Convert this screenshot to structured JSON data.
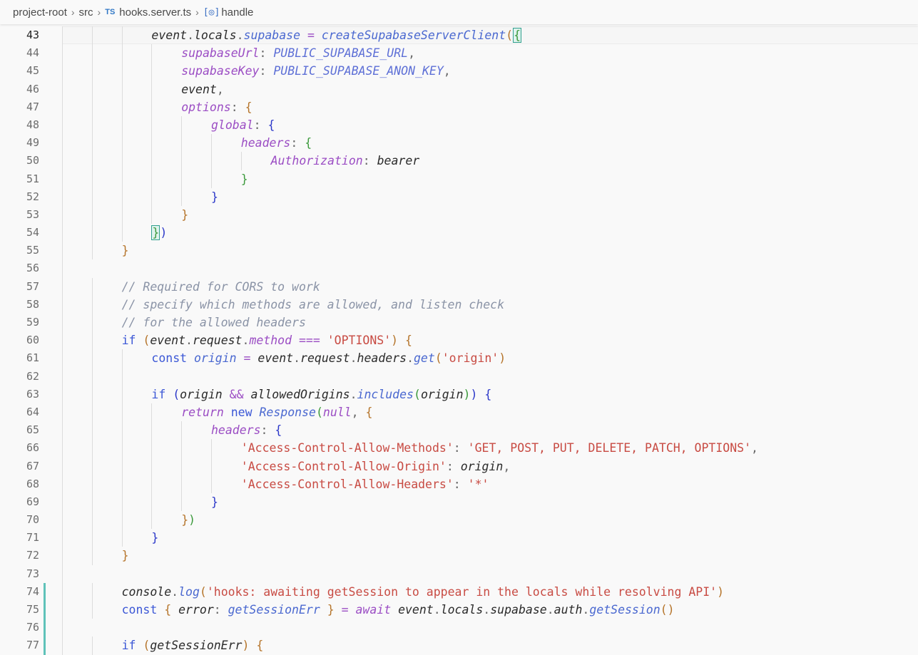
{
  "breadcrumb": {
    "root": "project-root",
    "folder": "src",
    "file_icon": "TS",
    "file": "hooks.server.ts",
    "symbol": "handle",
    "symbol_icon": "symbol-variable-icon"
  },
  "colors": {
    "keyword": "#3b57d6",
    "property": "#9b4dc4",
    "variable": "#2a2a2a",
    "function": "#4a68d0",
    "string": "#c84b43",
    "comment": "#8a93a6",
    "constant": "#5d6fd6",
    "operator": "#9b4dc4",
    "punctuation": "#666666",
    "bracket_1": "#b5742a",
    "bracket_2": "#2c38c9",
    "bracket_3": "#3c9a3c",
    "modified_gutter": "#5fc2b9"
  },
  "lines": [
    {
      "n": "43",
      "indent": 3,
      "current": true,
      "tokens": [
        [
          "event",
          "v"
        ],
        [
          ".",
          "p"
        ],
        [
          "locals",
          "v"
        ],
        [
          ".",
          "p"
        ],
        [
          "supabase",
          "f"
        ],
        [
          " = ",
          "o"
        ],
        [
          "createSupabaseServerClient",
          "f"
        ],
        [
          "(",
          "b1"
        ],
        [
          "{",
          "bm"
        ]
      ]
    },
    {
      "n": "44",
      "indent": 4,
      "tokens": [
        [
          "supabaseUrl",
          "pr"
        ],
        [
          ": ",
          "p"
        ],
        [
          "PUBLIC_SUPABASE_URL",
          "c"
        ],
        [
          ",",
          "p"
        ]
      ]
    },
    {
      "n": "45",
      "indent": 4,
      "tokens": [
        [
          "supabaseKey",
          "pr"
        ],
        [
          ": ",
          "p"
        ],
        [
          "PUBLIC_SUPABASE_ANON_KEY",
          "c"
        ],
        [
          ",",
          "p"
        ]
      ]
    },
    {
      "n": "46",
      "indent": 4,
      "tokens": [
        [
          "event",
          "v"
        ],
        [
          ",",
          "p"
        ]
      ]
    },
    {
      "n": "47",
      "indent": 4,
      "tokens": [
        [
          "options",
          "pr"
        ],
        [
          ": ",
          "p"
        ],
        [
          "{",
          "b1"
        ]
      ]
    },
    {
      "n": "48",
      "indent": 5,
      "tokens": [
        [
          "global",
          "pr"
        ],
        [
          ": ",
          "p"
        ],
        [
          "{",
          "b2"
        ]
      ]
    },
    {
      "n": "49",
      "indent": 6,
      "tokens": [
        [
          "headers",
          "pr"
        ],
        [
          ": ",
          "p"
        ],
        [
          "{",
          "b3"
        ]
      ]
    },
    {
      "n": "50",
      "indent": 7,
      "tokens": [
        [
          "Authorization",
          "pr"
        ],
        [
          ": ",
          "p"
        ],
        [
          "bearer",
          "v"
        ]
      ]
    },
    {
      "n": "51",
      "indent": 6,
      "tokens": [
        [
          "}",
          "b3"
        ]
      ]
    },
    {
      "n": "52",
      "indent": 5,
      "tokens": [
        [
          "}",
          "b2"
        ]
      ]
    },
    {
      "n": "53",
      "indent": 4,
      "tokens": [
        [
          "}",
          "b1"
        ]
      ]
    },
    {
      "n": "54",
      "indent": 3,
      "tokens": [
        [
          "}",
          "bm"
        ],
        [
          ")",
          "b2"
        ]
      ]
    },
    {
      "n": "55",
      "indent": 2,
      "tokens": [
        [
          "}",
          "b1"
        ]
      ]
    },
    {
      "n": "56",
      "indent": 1,
      "tokens": []
    },
    {
      "n": "57",
      "indent": 2,
      "tokens": [
        [
          "// Required for CORS to work",
          "cm"
        ]
      ]
    },
    {
      "n": "58",
      "indent": 2,
      "tokens": [
        [
          "// specify which methods are allowed, and listen check",
          "cm"
        ]
      ]
    },
    {
      "n": "59",
      "indent": 2,
      "tokens": [
        [
          "// for the allowed headers",
          "cm"
        ]
      ]
    },
    {
      "n": "60",
      "indent": 2,
      "tokens": [
        [
          "if ",
          "k"
        ],
        [
          "(",
          "b1"
        ],
        [
          "event",
          "v"
        ],
        [
          ".",
          "p"
        ],
        [
          "request",
          "v"
        ],
        [
          ".",
          "p"
        ],
        [
          "method",
          "pr"
        ],
        [
          " === ",
          "o"
        ],
        [
          "'OPTIONS'",
          "s"
        ],
        [
          ") ",
          "b1"
        ],
        [
          "{",
          "b1"
        ]
      ]
    },
    {
      "n": "61",
      "indent": 3,
      "tokens": [
        [
          "const ",
          "k"
        ],
        [
          "origin",
          "f"
        ],
        [
          " = ",
          "o"
        ],
        [
          "event",
          "v"
        ],
        [
          ".",
          "p"
        ],
        [
          "request",
          "v"
        ],
        [
          ".",
          "p"
        ],
        [
          "headers",
          "v"
        ],
        [
          ".",
          "p"
        ],
        [
          "get",
          "f"
        ],
        [
          "(",
          "b1"
        ],
        [
          "'origin'",
          "s"
        ],
        [
          ")",
          "b1"
        ]
      ]
    },
    {
      "n": "62",
      "indent": 3,
      "tokens": []
    },
    {
      "n": "63",
      "indent": 3,
      "tokens": [
        [
          "if ",
          "k"
        ],
        [
          "(",
          "b2"
        ],
        [
          "origin",
          "v"
        ],
        [
          " && ",
          "o"
        ],
        [
          "allowedOrigins",
          "v"
        ],
        [
          ".",
          "p"
        ],
        [
          "includes",
          "f"
        ],
        [
          "(",
          "b3"
        ],
        [
          "origin",
          "v"
        ],
        [
          ")",
          "b3"
        ],
        [
          ") ",
          "b2"
        ],
        [
          "{",
          "b2"
        ]
      ]
    },
    {
      "n": "64",
      "indent": 4,
      "tokens": [
        [
          "return ",
          "pr"
        ],
        [
          "new ",
          "k"
        ],
        [
          "Response",
          "f"
        ],
        [
          "(",
          "b3"
        ],
        [
          "null",
          "pr"
        ],
        [
          ", ",
          "p"
        ],
        [
          "{",
          "b1"
        ]
      ]
    },
    {
      "n": "65",
      "indent": 5,
      "tokens": [
        [
          "headers",
          "pr"
        ],
        [
          ": ",
          "p"
        ],
        [
          "{",
          "b2"
        ]
      ]
    },
    {
      "n": "66",
      "indent": 6,
      "tokens": [
        [
          "'Access-Control-Allow-Methods'",
          "s"
        ],
        [
          ": ",
          "p"
        ],
        [
          "'GET, POST, PUT, DELETE, PATCH, OPTIONS'",
          "s"
        ],
        [
          ",",
          "p"
        ]
      ]
    },
    {
      "n": "67",
      "indent": 6,
      "tokens": [
        [
          "'Access-Control-Allow-Origin'",
          "s"
        ],
        [
          ": ",
          "p"
        ],
        [
          "origin",
          "v"
        ],
        [
          ",",
          "p"
        ]
      ]
    },
    {
      "n": "68",
      "indent": 6,
      "tokens": [
        [
          "'Access-Control-Allow-Headers'",
          "s"
        ],
        [
          ": ",
          "p"
        ],
        [
          "'*'",
          "s"
        ]
      ]
    },
    {
      "n": "69",
      "indent": 5,
      "tokens": [
        [
          "}",
          "b2"
        ]
      ]
    },
    {
      "n": "70",
      "indent": 4,
      "tokens": [
        [
          "}",
          "b1"
        ],
        [
          ")",
          "b3"
        ]
      ]
    },
    {
      "n": "71",
      "indent": 3,
      "tokens": [
        [
          "}",
          "b2"
        ]
      ]
    },
    {
      "n": "72",
      "indent": 2,
      "tokens": [
        [
          "}",
          "b1"
        ]
      ]
    },
    {
      "n": "73",
      "indent": 1,
      "tokens": []
    },
    {
      "n": "74",
      "indent": 2,
      "modified": true,
      "tokens": [
        [
          "console",
          "v"
        ],
        [
          ".",
          "p"
        ],
        [
          "log",
          "f"
        ],
        [
          "(",
          "b1"
        ],
        [
          "'hooks: awaiting getSession to appear in the locals while resolving API'",
          "s"
        ],
        [
          ")",
          "b1"
        ]
      ]
    },
    {
      "n": "75",
      "indent": 2,
      "modified": true,
      "tokens": [
        [
          "const ",
          "k"
        ],
        [
          "{ ",
          "b1"
        ],
        [
          "error",
          "v"
        ],
        [
          ": ",
          "p"
        ],
        [
          "getSessionErr",
          "f"
        ],
        [
          " } ",
          "b1"
        ],
        [
          "= ",
          "o"
        ],
        [
          "await ",
          "pr"
        ],
        [
          "event",
          "v"
        ],
        [
          ".",
          "p"
        ],
        [
          "locals",
          "v"
        ],
        [
          ".",
          "p"
        ],
        [
          "supabase",
          "v"
        ],
        [
          ".",
          "p"
        ],
        [
          "auth",
          "v"
        ],
        [
          ".",
          "p"
        ],
        [
          "getSession",
          "f"
        ],
        [
          "()",
          "b1"
        ]
      ]
    },
    {
      "n": "76",
      "indent": 1,
      "modified": true,
      "tokens": []
    },
    {
      "n": "77",
      "indent": 2,
      "modified": true,
      "tokens": [
        [
          "if ",
          "k"
        ],
        [
          "(",
          "b1"
        ],
        [
          "getSessionErr",
          "v"
        ],
        [
          ") ",
          "b1"
        ],
        [
          "{",
          "b1"
        ]
      ]
    }
  ]
}
